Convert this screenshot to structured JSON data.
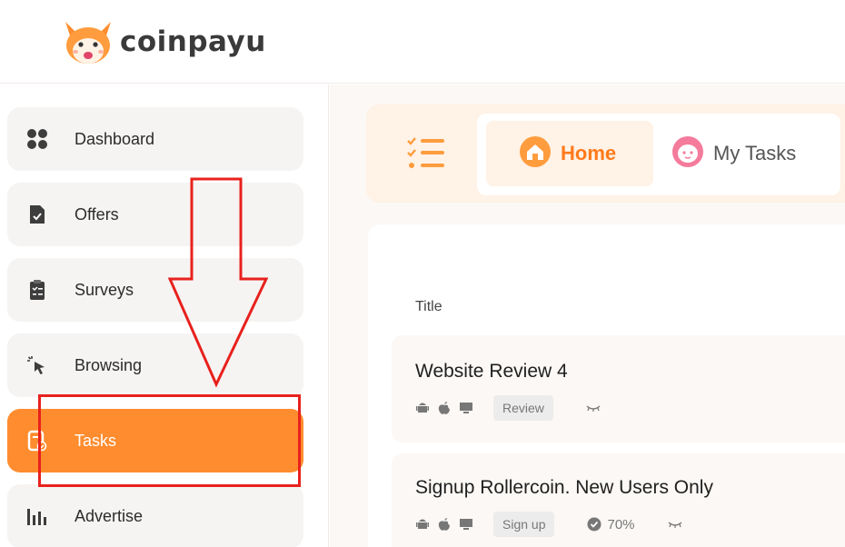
{
  "brand": {
    "name": "coinpayu"
  },
  "sidebar": {
    "items": [
      {
        "label": "Dashboard",
        "icon": "dashboard-icon"
      },
      {
        "label": "Offers",
        "icon": "offers-icon"
      },
      {
        "label": "Surveys",
        "icon": "surveys-icon"
      },
      {
        "label": "Browsing",
        "icon": "cursor-click-icon"
      },
      {
        "label": "Tasks",
        "icon": "tasks-icon",
        "active": true
      },
      {
        "label": "Advertise",
        "icon": "bar-chart-icon"
      }
    ]
  },
  "tabs": [
    {
      "label": "Home",
      "icon": "home-icon",
      "selected": true
    },
    {
      "label": "My Tasks",
      "icon": "mytasks-face-icon",
      "selected": false
    }
  ],
  "table": {
    "column_title": "Title"
  },
  "tasks": [
    {
      "title": "Website Review 4",
      "platforms": [
        "android-icon",
        "apple-icon",
        "desktop-icon"
      ],
      "tag": "Review"
    },
    {
      "title": "Signup Rollercoin. New Users Only",
      "platforms": [
        "android-icon",
        "apple-icon",
        "desktop-icon"
      ],
      "tag": "Sign up",
      "percent": "70%"
    }
  ],
  "colors": {
    "accent": "#ff8c2e",
    "annotation": "#e8211d"
  }
}
